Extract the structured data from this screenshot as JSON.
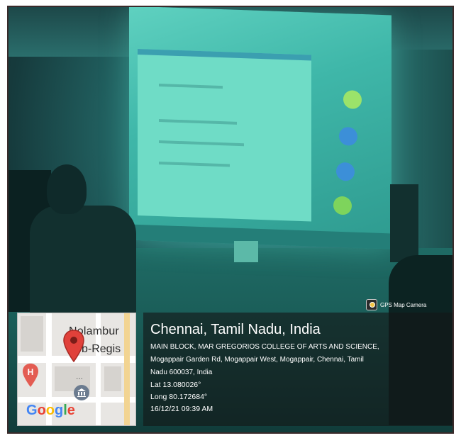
{
  "gps_badge": {
    "label": "GPS Map Camera",
    "icon": "gps-map-camera-icon"
  },
  "map": {
    "label_line1": "Nolambur",
    "label_line2": "b-Regis",
    "ellipsis": "...",
    "logo_text": "Google",
    "pin_color": "#e0413a",
    "icons": [
      "location-pin-icon",
      "hospital-icon",
      "museum-icon"
    ]
  },
  "location": {
    "city": "Chennai, Tamil Nadu, India",
    "address_line1": "MAIN BLOCK, MAR GREGORIOS COLLEGE OF ARTS AND SCIENCE,",
    "address_line2": "Mogappair Garden Rd, Mogappair West, Mogappair, Chennai, Tamil",
    "address_line3": "Nadu 600037, India",
    "lat": "Lat 13.080026°",
    "long": "Long 80.172684°",
    "datetime": "16/12/21 09:39 AM"
  },
  "colors": {
    "scene_tint": "#2f8a86",
    "panel_bg": "#141616"
  }
}
